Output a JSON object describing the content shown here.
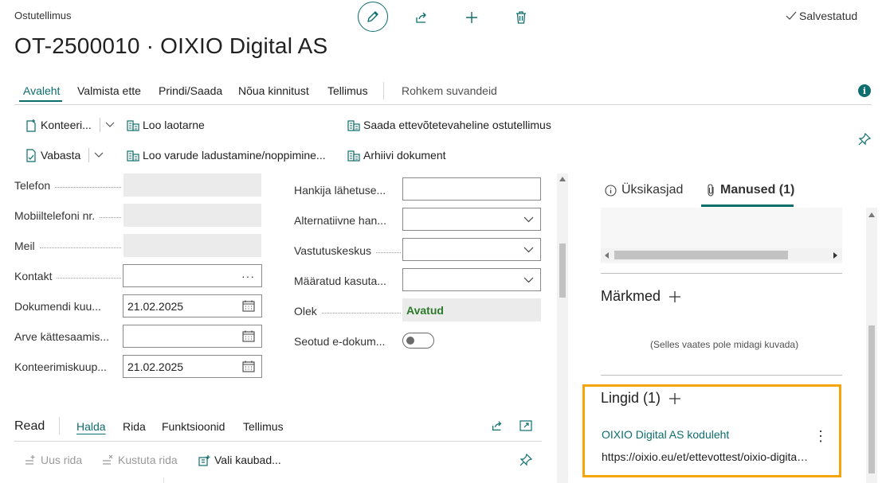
{
  "header": {
    "breadcrumb": "Ostutellimus",
    "title": "OT-2500010 · OIXIO Digital AS",
    "saved_label": "Salvestatud"
  },
  "action_tabs": {
    "home": "Avaleht",
    "prepare": "Valmista ette",
    "print_send": "Prindi/Saada",
    "request_approval": "Nõua kinnitust",
    "order": "Tellimus",
    "more_options": "Rohkem suvandeid"
  },
  "actions": {
    "post": "Konteeri...",
    "create_whse_receipt": "Loo laotarne",
    "send_ic_order": "Saada ettevõtetevaheline ostutellimus",
    "release": "Vabasta",
    "create_inventory_putaway": "Loo varude ladustamine/noppimine...",
    "archive_document": "Arhiivi dokument"
  },
  "form_left": {
    "phone": {
      "label": "Telefon",
      "value": ""
    },
    "mobile": {
      "label": "Mobiiltelefoni nr.",
      "value": ""
    },
    "email": {
      "label": "Meil",
      "value": ""
    },
    "contact": {
      "label": "Kontakt",
      "value": "",
      "more": "···"
    },
    "document_date": {
      "label": "Dokumendi kuu...",
      "value": "21.02.2025"
    },
    "invoice_received": {
      "label": "Arve kättesaamis...",
      "value": ""
    },
    "posting_date": {
      "label": "Konteerimiskuup...",
      "value": "21.02.2025"
    }
  },
  "form_right": {
    "vendor_shipment": {
      "label": "Hankija lähetuse...",
      "value": ""
    },
    "alt_vendor": {
      "label": "Alternatiivne han...",
      "value": ""
    },
    "responsibility_center": {
      "label": "Vastutuskeskus",
      "value": ""
    },
    "assigned_user": {
      "label": "Määratud kasuta...",
      "value": ""
    },
    "status": {
      "label": "Olek",
      "value": "Avatud"
    },
    "linked_edocs": {
      "label": "Seotud e-dokum..."
    }
  },
  "lines": {
    "title": "Read",
    "tabs": {
      "manage": "Halda",
      "line": "Rida",
      "functions": "Funktsioonid",
      "order": "Tellimus"
    },
    "new_line": "Uus rida",
    "delete_line": "Kustuta rida",
    "select_items": "Vali kaubad..."
  },
  "factbox": {
    "tabs": {
      "details": "Üksikasjad",
      "attachments": "Manused (1)"
    },
    "notes_title": "Märkmed",
    "notes_empty": "(Selles vaates pole midagi kuvada)",
    "links_title": "Lingid (1)",
    "link_name": "OIXIO Digital AS koduleht",
    "link_url": "https://oixio.eu/et/ettevottest/oixio-digital-as/",
    "more": "⋮"
  },
  "colors": {
    "accent": "#0e6d6d",
    "highlight": "#f5a50a",
    "status_green": "#2b7a2b"
  }
}
